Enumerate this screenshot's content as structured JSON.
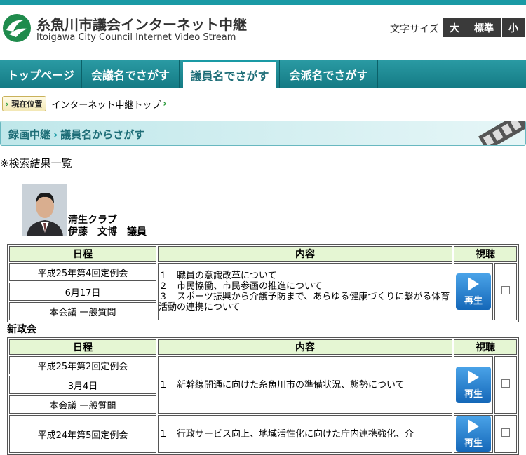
{
  "header": {
    "title": "糸魚川市議会インターネット中継",
    "subtitle": "Itoigawa City Council Internet Video Stream",
    "font_size_label": "文字サイズ",
    "font_sizes": [
      "大",
      "標準",
      "小"
    ]
  },
  "nav": {
    "tabs": [
      {
        "label": "トップページ"
      },
      {
        "label": "会議名でさがす"
      },
      {
        "label": "議員名でさがす",
        "active": true
      },
      {
        "label": "会派名でさがす"
      }
    ]
  },
  "breadcrumb": {
    "badge": "現在位置",
    "item": "インターネット中継トップ"
  },
  "section": {
    "part1": "録画中継",
    "part2": "議員名からさがす"
  },
  "results_label": "※検索結果一覧",
  "member": {
    "party": "清生クラブ",
    "name": "伊藤　文博　議員"
  },
  "table_headers": {
    "schedule": "日程",
    "content": "内容",
    "view": "視聴"
  },
  "play_label": "再生",
  "group2": "新政会",
  "records": [
    {
      "session": "平成25年第4回定例会",
      "date": "6月17日",
      "type": "本会議 一般質問",
      "content": [
        "１　職員の意識改革について",
        "２　市民協働、市民参画の推進について",
        "３　スポーツ振興から介護予防まで、あらゆる健康づくりに繋がる体育活動の連携について"
      ]
    },
    {
      "session": "平成25年第2回定例会",
      "date": "3月4日",
      "type": "本会議 一般質問",
      "content": [
        "１　新幹線開通に向けた糸魚川市の準備状況、態勢について"
      ]
    },
    {
      "session": "平成24年第5回定例会",
      "content": [
        "１　行政サービス向上、地域活性化に向けた庁内連携強化、介"
      ]
    }
  ],
  "colors": {
    "accent": "#1a9aa5",
    "header_cell": "#e5f6d3",
    "play": "#1467b8"
  }
}
